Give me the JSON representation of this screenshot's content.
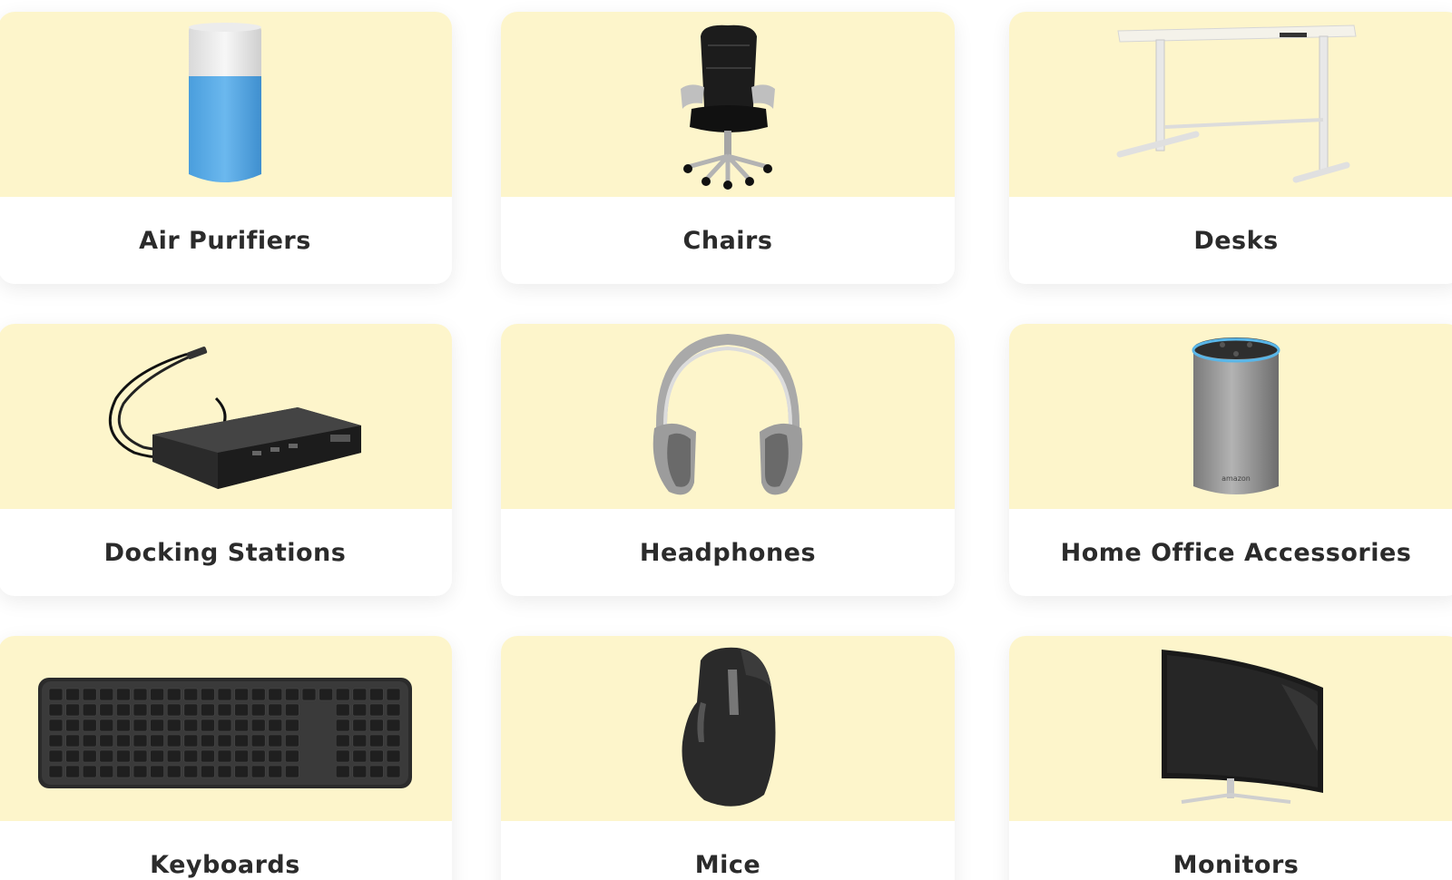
{
  "categories": [
    {
      "label": "Air Purifiers",
      "icon": "air-purifier-image"
    },
    {
      "label": "Chairs",
      "icon": "office-chair-image"
    },
    {
      "label": "Desks",
      "icon": "standing-desk-image"
    },
    {
      "label": "Docking Stations",
      "icon": "docking-station-image"
    },
    {
      "label": "Headphones",
      "icon": "headphones-image"
    },
    {
      "label": "Home Office Accessories",
      "icon": "smart-speaker-image"
    },
    {
      "label": "Keyboards",
      "icon": "keyboard-image"
    },
    {
      "label": "Mice",
      "icon": "mouse-image"
    },
    {
      "label": "Monitors",
      "icon": "curved-monitor-image"
    }
  ],
  "colors": {
    "image_background": "#fdf5cb",
    "card_background": "#ffffff",
    "label_text": "#2b2b2b"
  }
}
